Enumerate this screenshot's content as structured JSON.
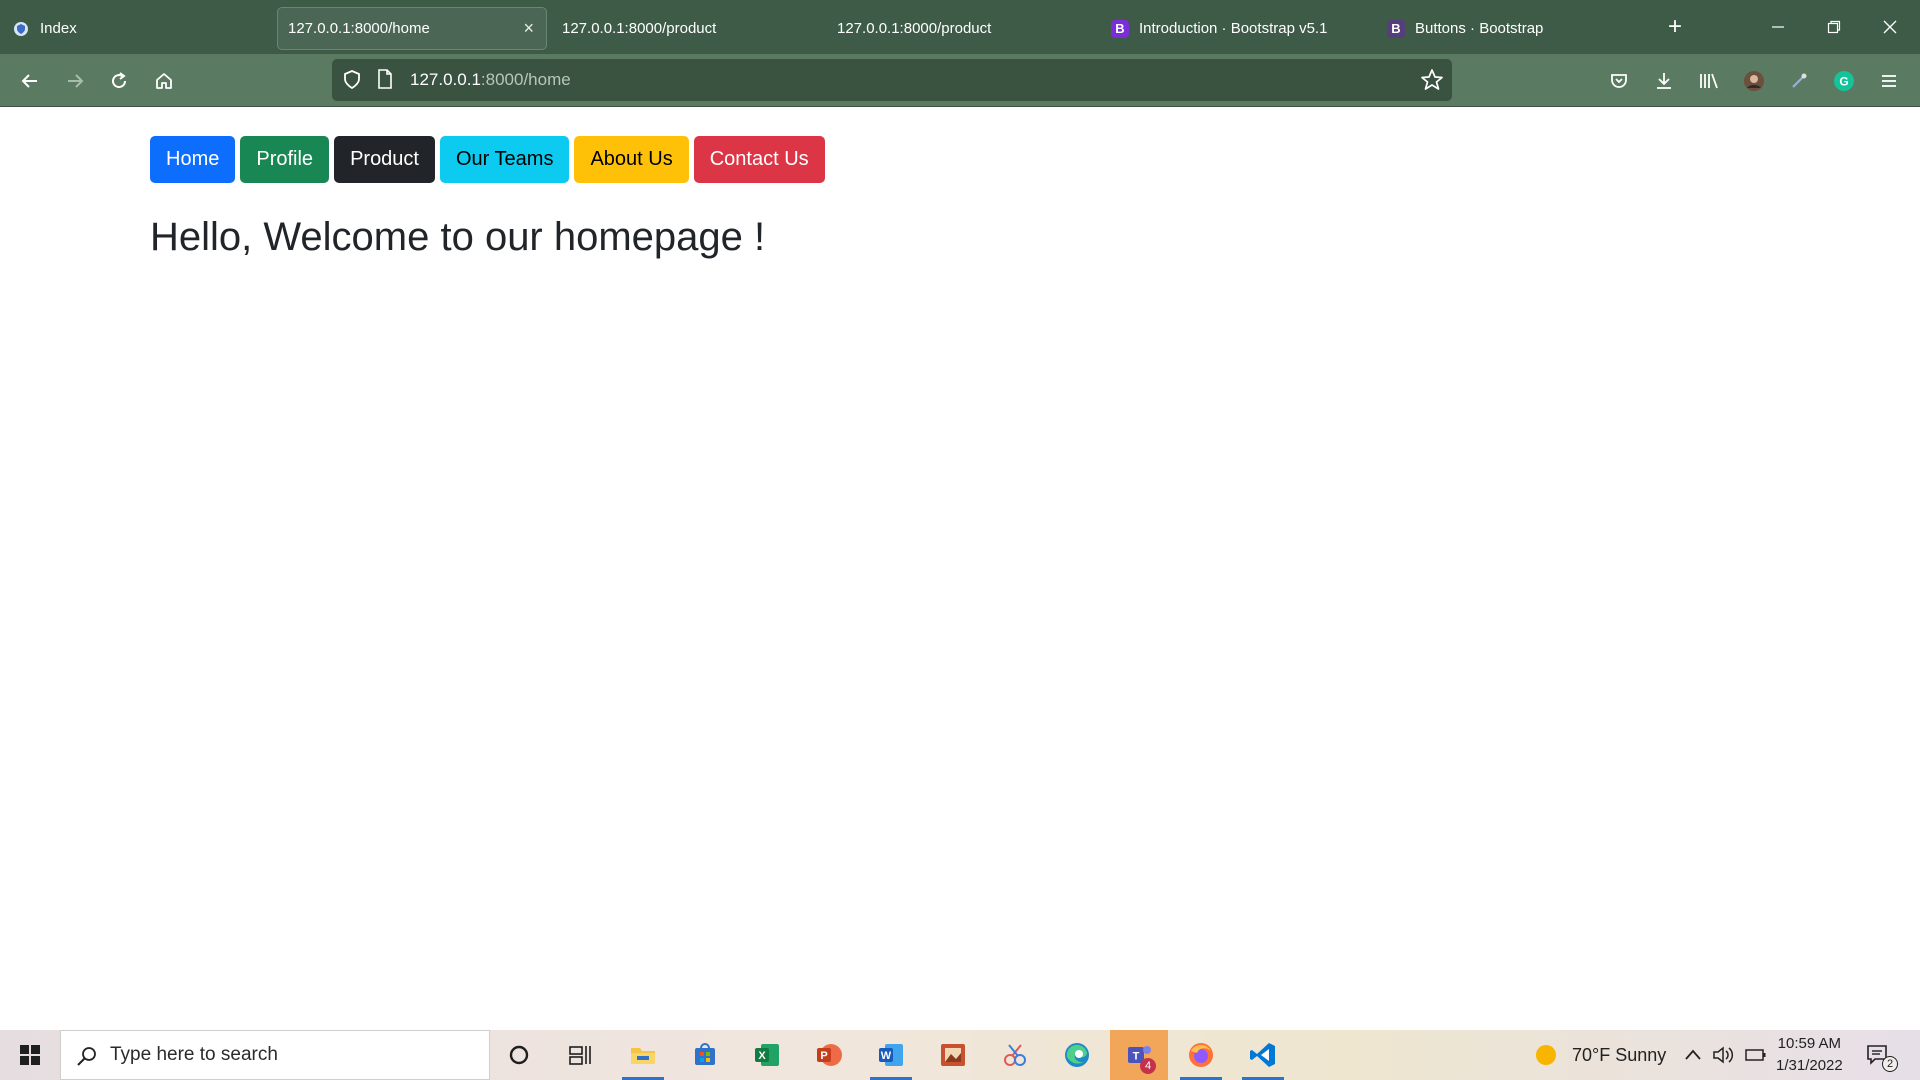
{
  "browser": {
    "tabs": [
      {
        "title": "Index",
        "icon": "shield-favicon-icon",
        "active": false
      },
      {
        "title": "127.0.0.1:8000/home",
        "active": true
      },
      {
        "title": "127.0.0.1:8000/product",
        "active": false
      },
      {
        "title": "127.0.0.1:8000/product",
        "active": false
      },
      {
        "title": "Introduction · Bootstrap v5.1",
        "icon": "bootstrap-icon",
        "active": false
      },
      {
        "title": "Buttons · Bootstrap",
        "icon": "bootstrap-icon",
        "active": false
      }
    ],
    "bootstrap_letter": "B",
    "new_tab": "+",
    "close_tab": "×",
    "url_host": "127.0.0.1",
    "url_path": ":8000/home"
  },
  "page": {
    "buttons": [
      {
        "label": "Home",
        "bg": "#0d6efd",
        "fg": "#ffffff"
      },
      {
        "label": "Profile",
        "bg": "#198754",
        "fg": "#ffffff"
      },
      {
        "label": "Product",
        "bg": "#212529",
        "fg": "#ffffff"
      },
      {
        "label": "Our Teams",
        "bg": "#0dcaf0",
        "fg": "#000000"
      },
      {
        "label": "About Us",
        "bg": "#ffc107",
        "fg": "#000000"
      },
      {
        "label": "Contact Us",
        "bg": "#dc3545",
        "fg": "#ffffff"
      }
    ],
    "heading": "Hello, Welcome to our homepage !"
  },
  "taskbar": {
    "search_placeholder": "Type here to search",
    "weather": "70°F  Sunny",
    "time": "10:59 AM",
    "date": "1/31/2022",
    "teams_badge": "4",
    "notification_count": "2",
    "apps": [
      "cortana-icon",
      "task-view-icon",
      "file-explorer-icon",
      "store-icon",
      "excel-icon",
      "powerpoint-icon",
      "word-icon",
      "photo-editor-icon",
      "snip-sketch-icon",
      "edge-icon",
      "teams-icon",
      "firefox-icon",
      "vscode-icon"
    ]
  }
}
